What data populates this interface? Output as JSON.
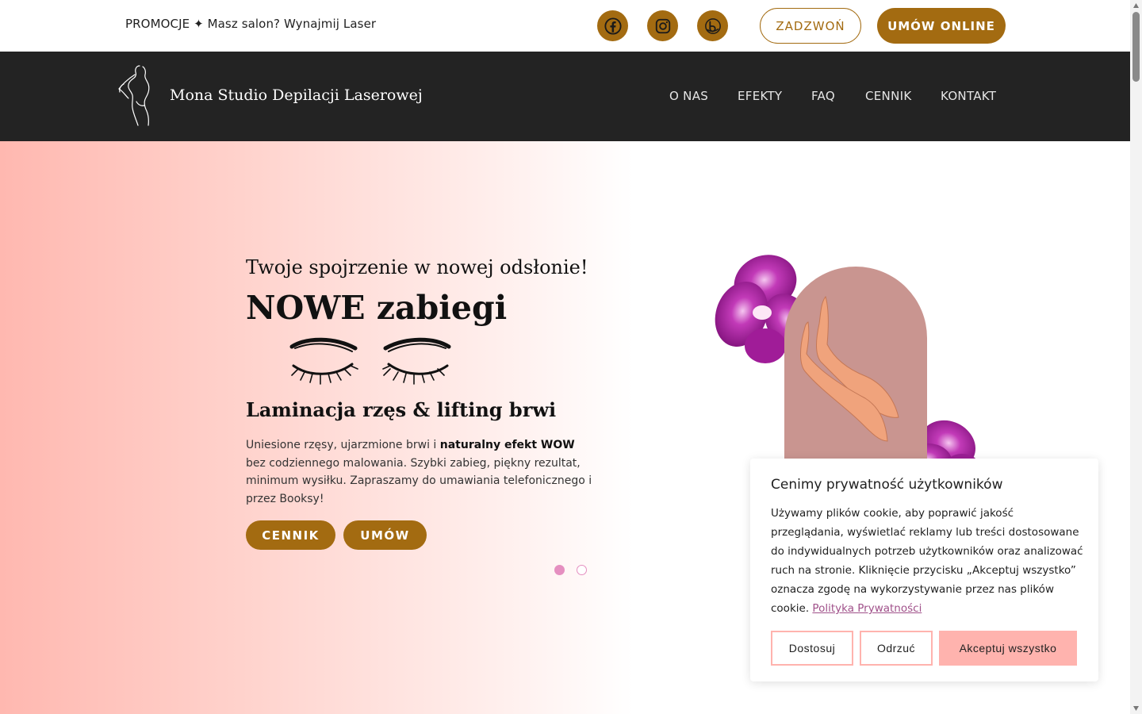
{
  "topbar": {
    "promo": "PROMOCJE ✦ Masz salon? Wynajmij Laser",
    "social": [
      "facebook-icon",
      "instagram-icon",
      "booksy-icon"
    ],
    "call_label": "ZADZWOŃ",
    "book_label": "UMÓW ONLINE"
  },
  "nav": {
    "brand": "Mona Studio Depilacji Laserowej",
    "items": [
      "O NAS",
      "EFEKTY",
      "FAQ",
      "CENNIK",
      "KONTAKT"
    ]
  },
  "hero": {
    "subtitle": "Twoje spojrzenie w nowej odsłonie!",
    "title": "NOWE zabiegi",
    "heading": "Laminacja rzęs & lifting brwi",
    "text_before": "Uniesione rzęsy, ujarzmione brwi i ",
    "text_bold": "naturalny efekt WOW",
    "text_after": " bez codziennego malowania. Szybki zabieg, piękny rezultat, minimum wysiłku. Zapraszamy do umawiania telefonicznego i przez Booksy!",
    "btn_price": "CENNIK",
    "btn_book": "UMÓW",
    "slides_total": 2,
    "slide_active": 1
  },
  "cookie": {
    "title": "Cenimy prywatność użytkowników",
    "text": "Używamy plików cookie, aby poprawić jakość przeglądania, wyświetlać reklamy lub treści dostosowane do indywidualnych potrzeb użytkowników oraz analizować ruch na stronie. Kliknięcie przycisku „Akceptuj wszystko” oznacza zgodę na wykorzystywanie przez nas plików cookie.",
    "link": "Polityka Prywatności",
    "customize": "Dostosuj",
    "reject": "Odrzuć",
    "accept": "Akceptuj wszystko"
  },
  "colors": {
    "brand_gold": "#a36b11",
    "nav_bg": "#232323",
    "pink_accent": "#ffb3ae",
    "dot": "#e58fc0"
  }
}
